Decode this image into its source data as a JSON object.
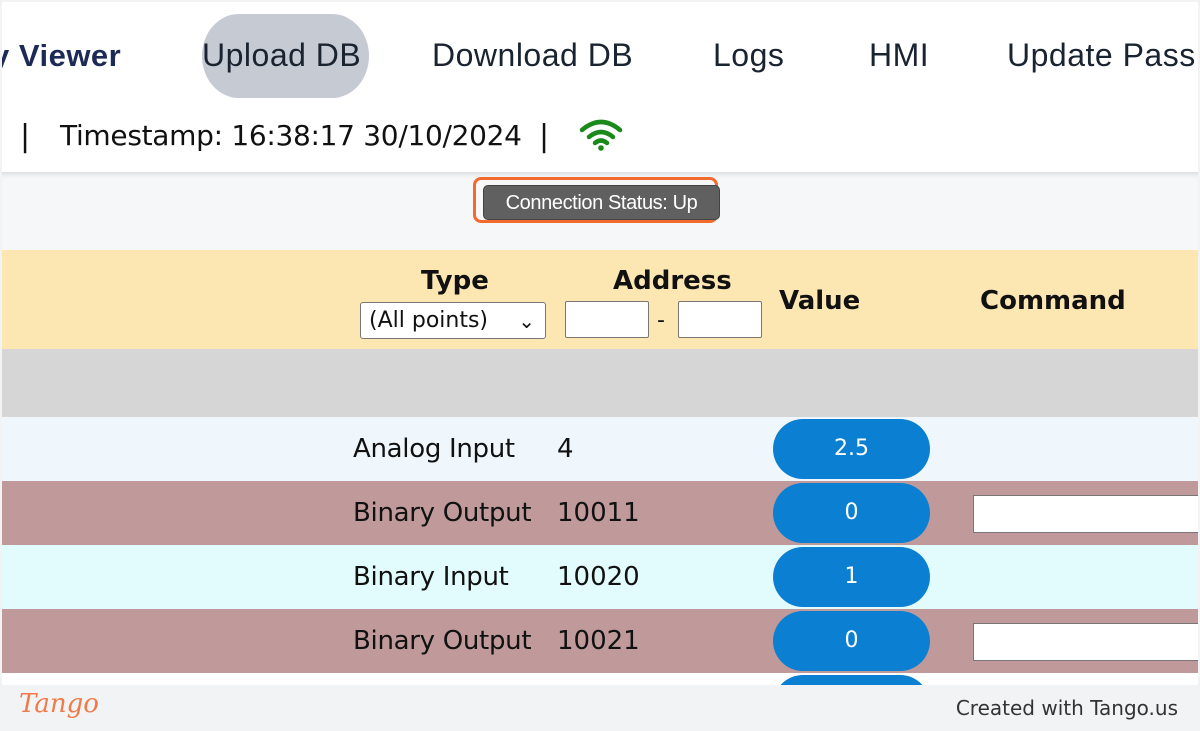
{
  "nav": {
    "brand": "y Viewer",
    "items": [
      "Upload DB",
      "Download DB",
      "Logs",
      "HMI",
      "Update Pass"
    ]
  },
  "status": {
    "separator": "|",
    "timestamp": "Timestamp: 16:38:17 30/10/2024",
    "wifi_icon": "wifi-icon",
    "wifi_color": "#1a8a1a"
  },
  "connection": {
    "label": "Connection Status: Up",
    "highlight_color": "#f26a2e"
  },
  "table": {
    "headers": {
      "type": "Type",
      "address": "Address",
      "value": "Value",
      "command": "Command"
    },
    "type_filter": "(All points)",
    "address_dash": "-",
    "rows": [
      {
        "type": "Analog Input",
        "address": "4",
        "value": "2.5",
        "has_command": false,
        "bg": "#f0f7fc"
      },
      {
        "type": "Binary Output",
        "address": "10011",
        "value": "0",
        "has_command": true,
        "bg": "#c09a9a"
      },
      {
        "type": "Binary Input",
        "address": "10020",
        "value": "1",
        "has_command": false,
        "bg": "#e2fcfd"
      },
      {
        "type": "Binary Output",
        "address": "10021",
        "value": "0",
        "has_command": true,
        "bg": "#c09a9a"
      }
    ]
  },
  "footer": {
    "logo": "Tango",
    "created": "Created with Tango.us"
  }
}
